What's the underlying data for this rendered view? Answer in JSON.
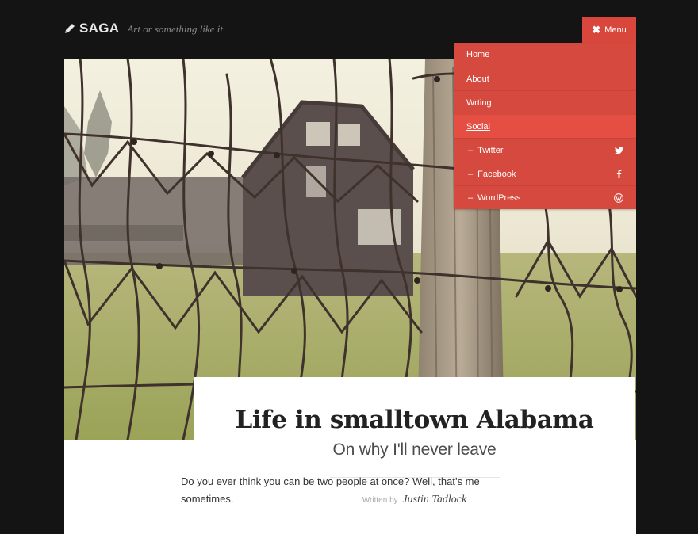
{
  "site": {
    "title": "SAGA",
    "description": "Art or something like it",
    "logo_icon": "pencil-icon"
  },
  "menu": {
    "toggle_label": "Menu",
    "toggle_icon": "close-icon",
    "items": [
      {
        "label": "Home",
        "sub": false,
        "active": false
      },
      {
        "label": "About",
        "sub": false,
        "active": false
      },
      {
        "label": "Wrting",
        "sub": false,
        "active": false
      },
      {
        "label": "Social",
        "sub": false,
        "active": true
      },
      {
        "label": "Twitter",
        "sub": true,
        "icon": "twitter-icon"
      },
      {
        "label": "Facebook",
        "sub": true,
        "icon": "facebook-icon"
      },
      {
        "label": "WordPress",
        "sub": true,
        "icon": "wordpress-icon"
      }
    ]
  },
  "post": {
    "title": "Life in smalltown Alabama",
    "subtitle": "On why I'll never leave",
    "byline_prefix": "Written by",
    "author": "Justin Tadlock",
    "content": "Do you ever think you can be two people at once? Well, that’s me sometimes."
  },
  "colors": {
    "accent": "#d9473c",
    "background": "#141414"
  }
}
